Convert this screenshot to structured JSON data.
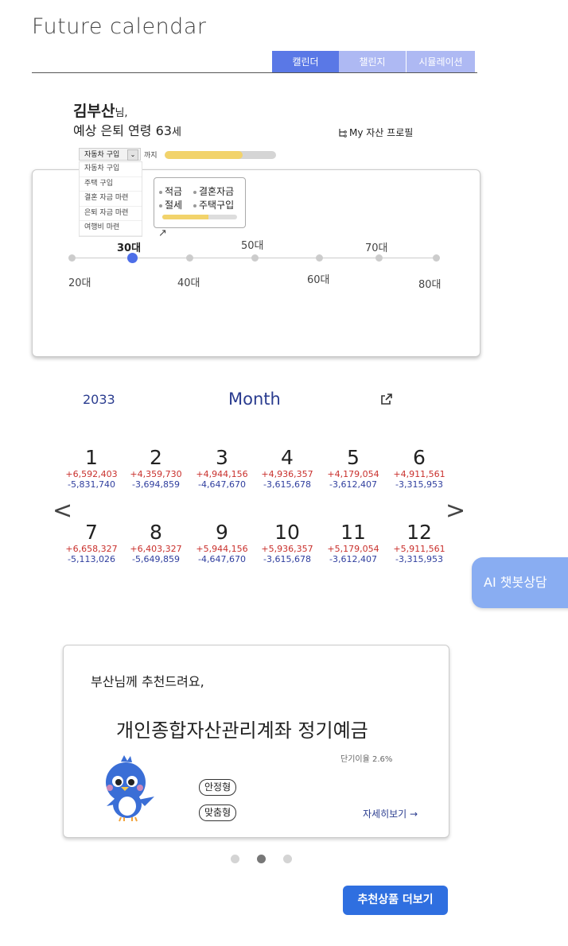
{
  "app": {
    "title": "Future calendar"
  },
  "tabs": [
    {
      "label": "캘린더"
    },
    {
      "label": "챌린지"
    },
    {
      "label": "시뮬레이션"
    }
  ],
  "greeting": {
    "name": "김부산",
    "honorific": "님,",
    "age_prefix": "예상 은퇴 연령",
    "age_value": "63",
    "age_suffix": "세"
  },
  "profile_link": {
    "icon": "tree-structure-icon",
    "label": "My 자산 프로필"
  },
  "goal": {
    "selected": "자동차 구입",
    "until_label": "까지",
    "progress_percent": 70,
    "options": [
      "자동차 구입",
      "주택 구입",
      "결혼 자금 마련",
      "은퇴 자금 마련",
      "여행비 마련"
    ]
  },
  "tooltip": {
    "items": [
      "적금",
      "결혼자금",
      "절세",
      "주택구입"
    ],
    "progress_percent": 62
  },
  "timeline": {
    "ages": [
      "20대",
      "30대",
      "40대",
      "50대",
      "60대",
      "70대",
      "80대"
    ],
    "active_index": 1
  },
  "calendar": {
    "year": "2033",
    "view_mode": "Month",
    "prev": "<",
    "next": ">",
    "months": [
      {
        "num": "1",
        "income": "+6,592,403",
        "expense": "-5,831,740"
      },
      {
        "num": "2",
        "income": "+4,359,730",
        "expense": "-3,694,859"
      },
      {
        "num": "3",
        "income": "+4,944,156",
        "expense": "-4,647,670"
      },
      {
        "num": "4",
        "income": "+4,936,357",
        "expense": "-3,615,678"
      },
      {
        "num": "5",
        "income": "+4,179,054",
        "expense": "-3,612,407"
      },
      {
        "num": "6",
        "income": "+4,911,561",
        "expense": "-3,315,953"
      },
      {
        "num": "7",
        "income": "+6,658,327",
        "expense": "-5,113,026"
      },
      {
        "num": "8",
        "income": "+6,403,327",
        "expense": "-5,649,859"
      },
      {
        "num": "9",
        "income": "+5,944,156",
        "expense": "-4,647,670"
      },
      {
        "num": "10",
        "income": "+5,936,357",
        "expense": "-3,615,678"
      },
      {
        "num": "11",
        "income": "+5,179,054",
        "expense": "-3,612,407"
      },
      {
        "num": "12",
        "income": "+5,911,561",
        "expense": "-3,315,953"
      }
    ]
  },
  "chatbot": {
    "label": "AI 챗봇상담"
  },
  "recommendation": {
    "intro": "부산님께 추천드려요,",
    "product": "개인종합자산관리계좌 정기예금",
    "rate": "단기이율 2.6%",
    "tags": [
      "안정형",
      "맞춤형"
    ],
    "detail_link": "자세히보기 →",
    "active_page": 2,
    "page_count": 3
  },
  "more_button": {
    "label": "추천상품 더보기"
  },
  "colors": {
    "primary": "#5a78e6",
    "tab_inactive": "#aeb9f3",
    "income": "#c9302c",
    "expense": "#2f3e9e",
    "progress": "#f2d36b",
    "chatbot": "#89adf2",
    "button": "#2f6fe0"
  }
}
